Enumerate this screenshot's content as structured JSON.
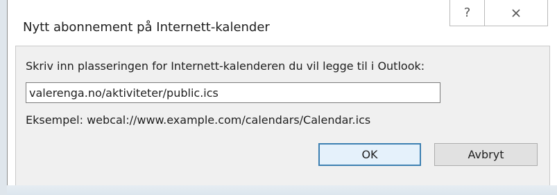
{
  "dialog": {
    "title": "Nytt abonnement på Internett-kalender",
    "help_glyph": "?",
    "instruction": "Skriv inn plasseringen for Internett-kalenderen du vil legge til i Outlook:",
    "url_value": "valerenga.no/aktiviteter/public.ics",
    "example": "Eksempel: webcal://www.example.com/calendars/Calendar.ics",
    "ok_label": "OK",
    "cancel_label": "Avbryt"
  },
  "icons": {
    "help": "help-icon",
    "close": "close-icon"
  },
  "colors": {
    "accent": "#3c7fb1",
    "client_bg": "#f0f0f0"
  }
}
